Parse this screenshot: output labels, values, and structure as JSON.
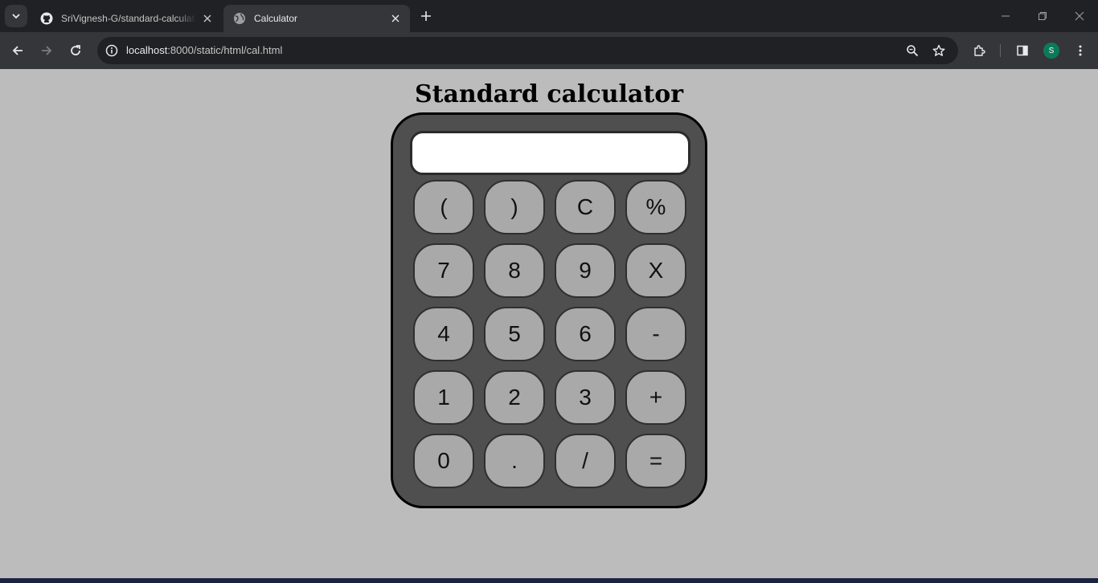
{
  "browser": {
    "tabs": [
      {
        "title": "SriVignesh-G/standard-calculator",
        "favicon": "github-icon",
        "active": false
      },
      {
        "title": "Calculator",
        "favicon": "globe-icon",
        "active": true
      }
    ],
    "address": {
      "host": "localhost",
      "path": ":8000/static/html/cal.html"
    },
    "profile_initial": "S",
    "icons": [
      "tab-search-icon",
      "close-icon",
      "new-tab-icon",
      "minimize-icon",
      "maximize-icon",
      "back-icon",
      "forward-icon",
      "reload-icon",
      "site-info-icon",
      "zoom-icon",
      "bookmark-star-icon",
      "extensions-icon",
      "side-panel-icon",
      "menu-icon"
    ]
  },
  "page": {
    "title": "Standard calculator",
    "display_value": ""
  },
  "keypad": {
    "rows": [
      [
        "(",
        ")",
        "C",
        "%"
      ],
      [
        "7",
        "8",
        "9",
        "X"
      ],
      [
        "4",
        "5",
        "6",
        "-"
      ],
      [
        "1",
        "2",
        "3",
        "+"
      ],
      [
        "0",
        ".",
        "/",
        "="
      ]
    ]
  },
  "colors": {
    "page_background": "#bcbcbc",
    "calculator_body": "#4f4f4f",
    "key_background": "#a9a9a9",
    "display_background": "#ffffff"
  }
}
